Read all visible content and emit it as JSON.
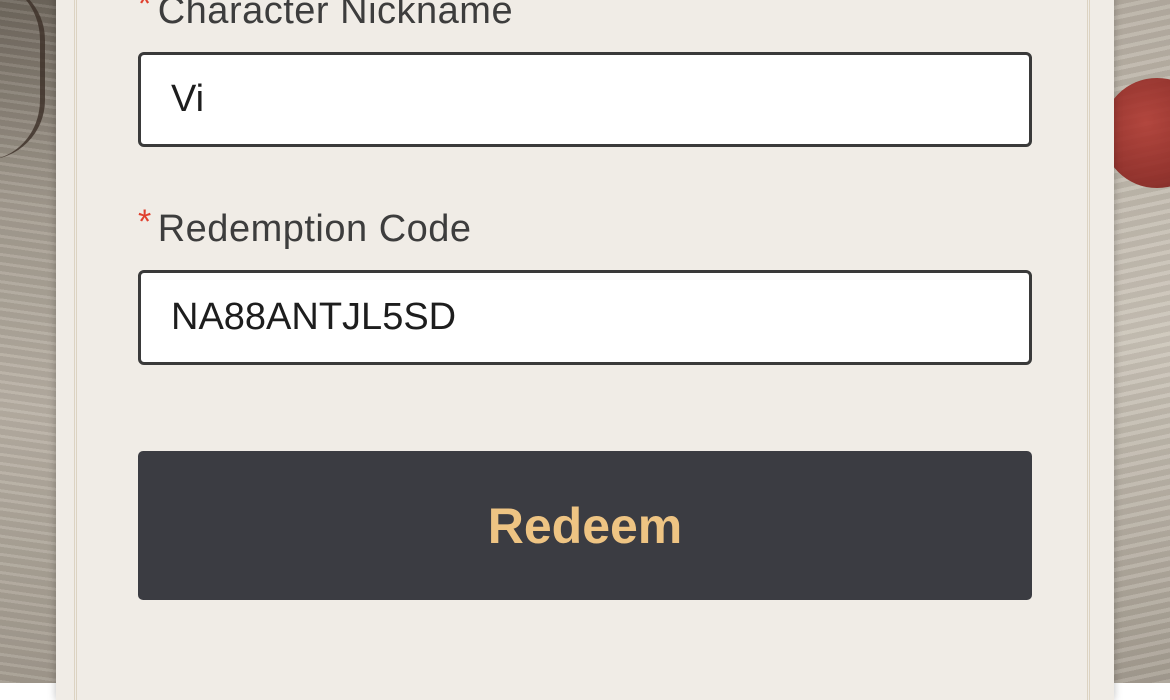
{
  "form": {
    "required_marker": "*",
    "nickname": {
      "label": "Character Nickname",
      "value": "Vi"
    },
    "code": {
      "label": "Redemption Code",
      "value": "NA88ANTJL5SD"
    },
    "submit_label": "Redeem"
  },
  "colors": {
    "button_bg": "#3b3c42",
    "button_text": "#eec483",
    "required_marker": "#e0402e",
    "panel_bg": "#f0ece6"
  }
}
